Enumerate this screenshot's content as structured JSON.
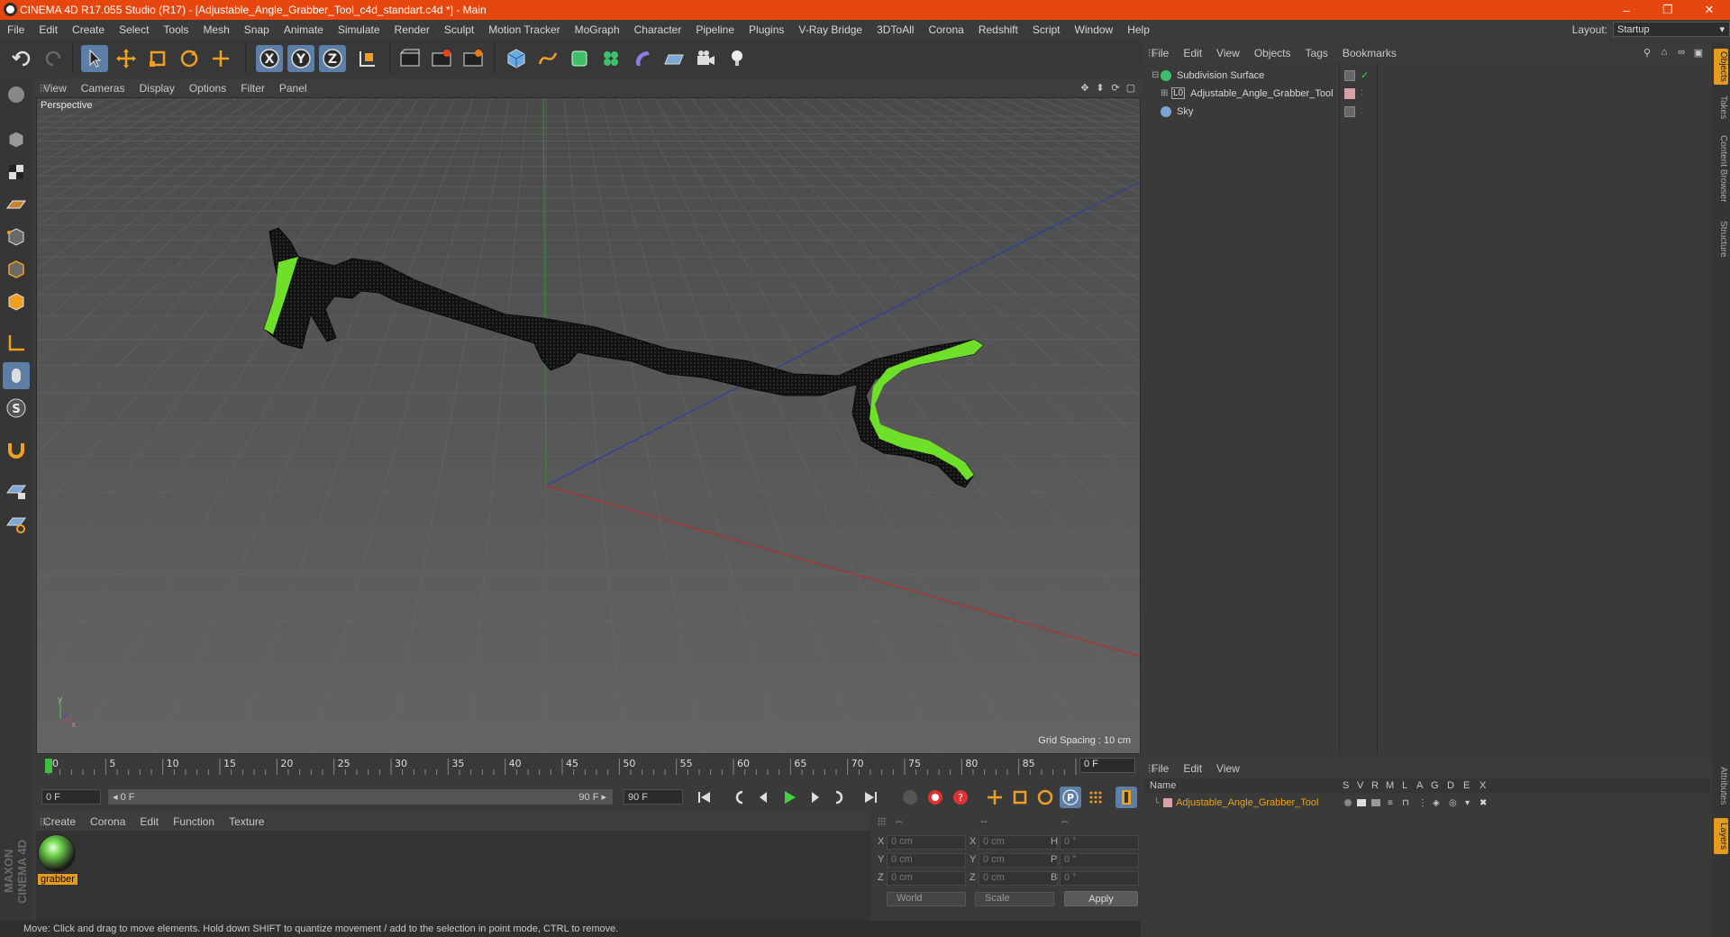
{
  "window": {
    "title": "CINEMA 4D R17.055 Studio (R17) - [Adjustable_Angle_Grabber_Tool_c4d_standart.c4d *] - Main",
    "controls": [
      "–",
      "❐",
      "✕"
    ]
  },
  "menubar": {
    "items": [
      "File",
      "Edit",
      "Create",
      "Select",
      "Tools",
      "Mesh",
      "Snap",
      "Animate",
      "Simulate",
      "Render",
      "Sculpt",
      "Motion Tracker",
      "MoGraph",
      "Character",
      "Pipeline",
      "Plugins",
      "V-Ray Bridge",
      "3DToAll",
      "Corona",
      "Redshift",
      "Script",
      "Window",
      "Help"
    ],
    "layout_label": "Layout:",
    "layout_value": "Startup"
  },
  "toolbar": {
    "icons": [
      "undo-icon",
      "redo-icon",
      "live-selection-icon",
      "move-icon",
      "scale-icon",
      "rotate-icon",
      "move-axis-icon",
      "x-axis-lock-icon",
      "y-axis-lock-icon",
      "z-axis-lock-icon",
      "coordinate-system-icon",
      "render-view-icon",
      "render-picture-viewer-icon",
      "edit-render-settings-icon",
      "cube-icon",
      "pen-spline-icon",
      "subdivision-icon",
      "cloner-icon",
      "deformer-icon",
      "floor-icon",
      "camera-icon",
      "light-icon"
    ]
  },
  "viewport": {
    "menu": [
      "View",
      "Cameras",
      "Display",
      "Options",
      "Filter",
      "Panel"
    ],
    "label": "Perspective",
    "grid_spacing": "Grid Spacing : 10 cm"
  },
  "timeline": {
    "ticks": [
      "0",
      "5",
      "10",
      "15",
      "20",
      "25",
      "30",
      "35",
      "40",
      "45",
      "50",
      "55",
      "60",
      "65",
      "70",
      "75",
      "80",
      "85",
      "90"
    ],
    "current_frame": "0 F",
    "start_field": "0 F",
    "range_start": "◂ 0 F",
    "range_end": "90 F ▸",
    "end_field": "90 F"
  },
  "material_manager": {
    "menu": [
      "Create",
      "Corona",
      "Edit",
      "Function",
      "Texture"
    ],
    "materials": [
      {
        "name": "grabber"
      }
    ]
  },
  "coordinates": {
    "header": [
      "--",
      "--",
      "--"
    ],
    "rows": [
      {
        "a": "X",
        "av": "0 cm",
        "b": "X",
        "bv": "0 cm",
        "c": "H",
        "cv": "0 °"
      },
      {
        "a": "Y",
        "av": "0 cm",
        "b": "Y",
        "bv": "0 cm",
        "c": "P",
        "cv": "0 °"
      },
      {
        "a": "Z",
        "av": "0 cm",
        "b": "Z",
        "bv": "0 cm",
        "c": "B",
        "cv": "0 °"
      }
    ],
    "space": "World",
    "mode": "Scale",
    "apply": "Apply"
  },
  "status": "Move: Click and drag to move elements. Hold down SHIFT to quantize movement / add to the selection in point mode, CTRL to remove.",
  "objects_panel": {
    "menu": [
      "File",
      "Edit",
      "View",
      "Objects",
      "Tags",
      "Bookmarks"
    ],
    "objects": [
      {
        "name": "Subdivision Surface",
        "color": "#3fbf6a"
      },
      {
        "name": "Adjustable_Angle_Grabber_Tool",
        "color": "#9ab"
      },
      {
        "name": "Sky",
        "color": "#7aa7d6"
      }
    ]
  },
  "right_tabs": [
    "Objects",
    "Takes",
    "Content Browser",
    "Structure",
    "Attributes",
    "Layers"
  ],
  "layers_panel": {
    "menu": [
      "File",
      "Edit",
      "View"
    ],
    "columns": [
      "Name",
      "S",
      "V",
      "R",
      "M",
      "L",
      "A",
      "G",
      "D",
      "E",
      "X"
    ],
    "layer_name": "Adjustable_Angle_Grabber_Tool"
  },
  "brand": "MAXON CINEMA 4D",
  "colors": {
    "accent": "#e8460f",
    "selection": "#5d7ea6",
    "highlight": "#e89b1a",
    "model_green": "#6fe02a"
  }
}
